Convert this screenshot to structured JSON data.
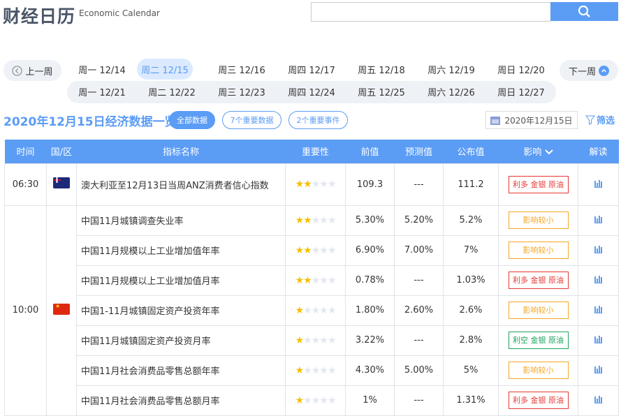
{
  "header": {
    "title": "财经日历",
    "subtitle": "Economic Calendar",
    "search_placeholder": ""
  },
  "week_nav": {
    "prev": "上一周",
    "next": "下一周",
    "week1": [
      "周一 12/14",
      "周二 12/15",
      "周三 12/16",
      "周四 12/17",
      "周五 12/18",
      "周六 12/19",
      "周日 12/20"
    ],
    "week2": [
      "周一 12/21",
      "周二 12/22",
      "周三 12/23",
      "周四 12/24",
      "周五 12/25",
      "周六 12/26",
      "周日 12/27"
    ],
    "active_index": 1
  },
  "summary": {
    "title": "2020年12月15日经济数据一览",
    "filters": [
      "全部数据",
      "7个重要数据",
      "2个重要事件"
    ],
    "date": "2020年12月15日",
    "filter_label": "筛选"
  },
  "table": {
    "headers": [
      "时间",
      "国/区",
      "指标名称",
      "重要性",
      "前值",
      "预测值",
      "公布值",
      "影响",
      "解读"
    ],
    "rows": [
      {
        "time": "06:30",
        "country": "australia",
        "name": "澳大利亚至12月13日当周ANZ消费者信心指数",
        "stars": 2,
        "prev": "109.3",
        "forecast": "---",
        "actual": "111.2",
        "impact": "利多 金银 原油",
        "impact_type": "bull"
      },
      {
        "time": "10:00",
        "country": "china",
        "name": "中国11月城镇调查失业率",
        "stars": 2,
        "prev": "5.30%",
        "forecast": "5.20%",
        "actual": "5.2%",
        "impact": "影响较小",
        "impact_type": "minor"
      },
      {
        "name": "中国11月规模以上工业增加值年率",
        "stars": 2,
        "prev": "6.90%",
        "forecast": "7.00%",
        "actual": "7%",
        "impact": "影响较小",
        "impact_type": "minor"
      },
      {
        "name": "中国11月规模以上工业增加值月率",
        "stars": 2,
        "prev": "0.78%",
        "forecast": "---",
        "actual": "1.03%",
        "impact": "利多 金银 原油",
        "impact_type": "bull"
      },
      {
        "name": "中国1-11月城镇固定资产投资年率",
        "stars": 1,
        "prev": "1.80%",
        "forecast": "2.60%",
        "actual": "2.6%",
        "impact": "影响较小",
        "impact_type": "minor"
      },
      {
        "name": "中国11月城镇固定资产投资月率",
        "stars": 1,
        "prev": "3.22%",
        "forecast": "---",
        "actual": "2.8%",
        "impact": "利空 金银 原油",
        "impact_type": "bear"
      },
      {
        "name": "中国11月社会消费品零售总额年率",
        "stars": 1,
        "prev": "4.30%",
        "forecast": "5.00%",
        "actual": "5%",
        "impact": "影响较小",
        "impact_type": "minor"
      },
      {
        "name": "中国11月社会消费品零售总额月率",
        "stars": 1,
        "prev": "1%",
        "forecast": "---",
        "actual": "1.31%",
        "impact": "利多 金银 原油",
        "impact_type": "bull"
      }
    ]
  },
  "colors": {
    "accent": "#5b9cf5",
    "bull": "#e53935",
    "bear": "#1aa35a",
    "minor": "#f5a623",
    "star": "#f5c000"
  }
}
